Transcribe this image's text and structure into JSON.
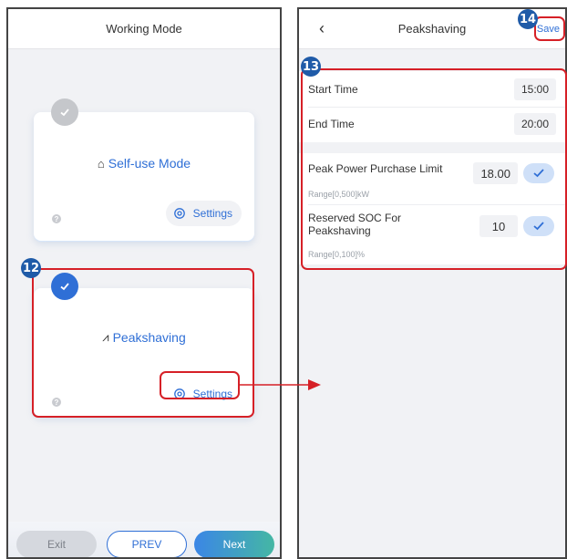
{
  "left": {
    "title": "Working Mode",
    "modes": [
      {
        "name": "Self-use Mode",
        "settings_label": "Settings",
        "selected": false,
        "icon": "house-icon"
      },
      {
        "name": "Peakshaving",
        "settings_label": "Settings",
        "selected": true,
        "icon": "peak-icon"
      }
    ],
    "buttons": {
      "exit": "Exit",
      "prev": "PREV",
      "next": "Next"
    }
  },
  "right": {
    "back_icon": "chevron-left-icon",
    "title": "Peakshaving",
    "save_label": "Save",
    "start_time_label": "Start Time",
    "start_time_value": "15:00",
    "end_time_label": "End Time",
    "end_time_value": "20:00",
    "peak_limit_label": "Peak Power Purchase Limit",
    "peak_limit_value": "18.00",
    "peak_limit_range": "Range[0,500]kW",
    "soc_label_line1": "Reserved SOC For",
    "soc_label_line2": "Peakshaving",
    "soc_value": "10",
    "soc_range": "Range[0,100]%"
  },
  "annotations": {
    "step12": "12",
    "step13": "13",
    "step14": "14"
  },
  "colors": {
    "accent": "#2f6fd6",
    "highlight": "#d62027",
    "badge": "#1f5ba8"
  }
}
